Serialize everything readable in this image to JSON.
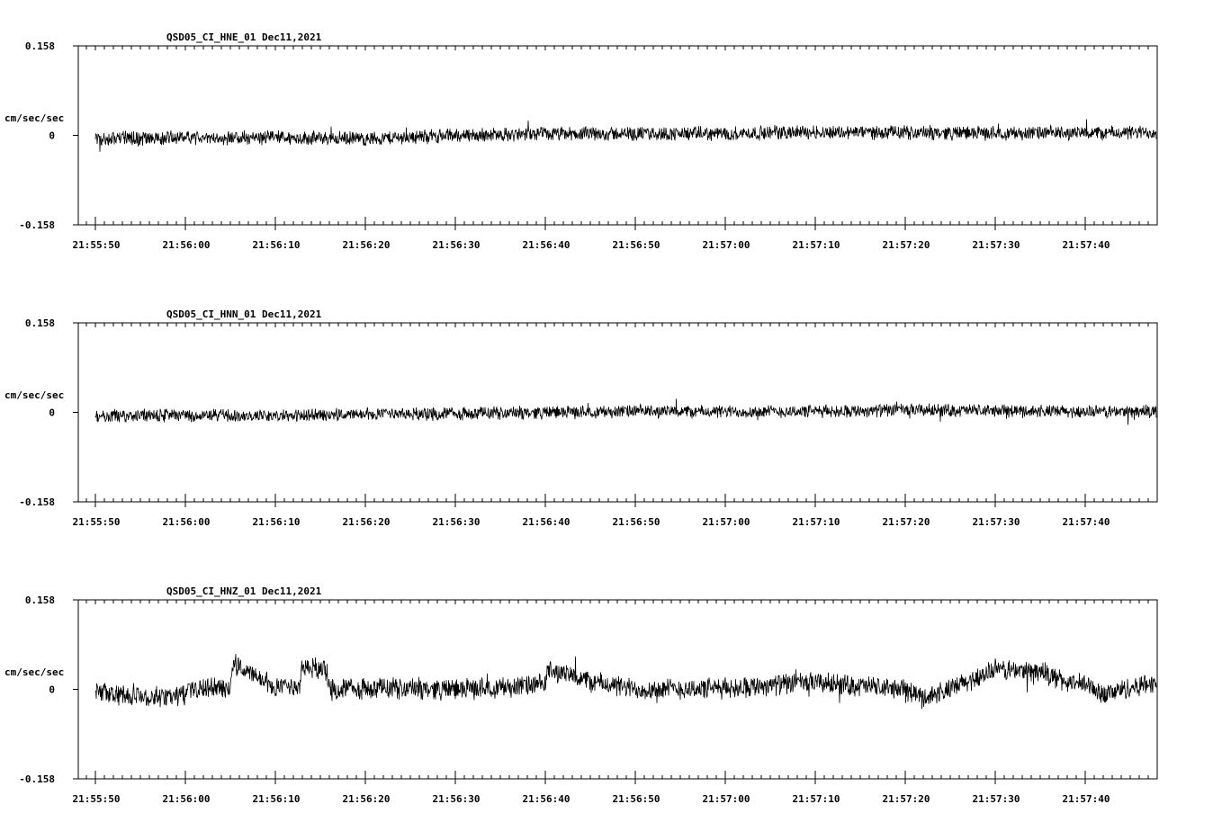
{
  "chart_data": [
    {
      "type": "line",
      "title": "QSD05_CI_HNE_01  Dec11,2021",
      "ylabel": "cm/sec/sec",
      "ylim": [
        -0.158,
        0.158
      ],
      "y_ticks": [
        "0.158",
        "0",
        "-0.158"
      ],
      "x_ticks": [
        "21:55:50",
        "21:56:00",
        "21:56:10",
        "21:56:20",
        "21:56:30",
        "21:56:40",
        "21:56:50",
        "21:57:00",
        "21:57:10",
        "21:57:20",
        "21:57:30",
        "21:57:40"
      ],
      "series": [
        {
          "color": "#000000",
          "noise_amplitude": 0.012,
          "baseline_x": [
            0,
            10,
            20,
            30,
            40,
            50,
            60,
            70,
            80,
            90,
            100,
            110,
            118
          ],
          "baseline_y": [
            -0.006,
            -0.005,
            -0.004,
            -0.006,
            0.0,
            0.002,
            0.003,
            0.003,
            0.006,
            0.005,
            0.004,
            0.004,
            0.005
          ]
        }
      ]
    },
    {
      "type": "line",
      "title": "QSD05_CI_HNN_01  Dec11,2021",
      "ylabel": "cm/sec/sec",
      "ylim": [
        -0.158,
        0.158
      ],
      "y_ticks": [
        "0.158",
        "0",
        "-0.158"
      ],
      "x_ticks": [
        "21:55:50",
        "21:56:00",
        "21:56:10",
        "21:56:20",
        "21:56:30",
        "21:56:40",
        "21:56:50",
        "21:57:00",
        "21:57:10",
        "21:57:20",
        "21:57:30",
        "21:57:40"
      ],
      "series": [
        {
          "color": "#000000",
          "noise_amplitude": 0.011,
          "baseline_x": [
            0,
            10,
            20,
            30,
            40,
            50,
            60,
            70,
            80,
            90,
            100,
            110,
            118
          ],
          "baseline_y": [
            -0.007,
            -0.005,
            -0.006,
            -0.004,
            -0.002,
            0.0,
            0.002,
            0.001,
            0.002,
            0.004,
            0.003,
            0.001,
            0.002
          ]
        }
      ]
    },
    {
      "type": "line",
      "title": "QSD05_CI_HNZ_01  Dec11,2021",
      "ylabel": "cm/sec/sec",
      "ylim": [
        -0.158,
        0.158
      ],
      "y_ticks": [
        "0.158",
        "0",
        "-0.158"
      ],
      "x_ticks": [
        "21:55:50",
        "21:56:00",
        "21:56:10",
        "21:56:20",
        "21:56:30",
        "21:56:40",
        "21:56:50",
        "21:57:00",
        "21:57:10",
        "21:57:20",
        "21:57:30",
        "21:57:40"
      ],
      "series": [
        {
          "color": "#000000",
          "noise_amplitude": 0.018,
          "baseline_x": [
            0,
            3,
            6,
            9,
            10,
            10.3,
            12,
            15,
            15.3,
            20,
            22.7,
            23,
            25.7,
            26,
            30,
            35,
            40,
            50,
            50.3,
            55,
            60,
            70,
            75,
            80,
            90,
            92,
            95,
            100,
            105,
            108,
            110,
            112,
            118
          ],
          "baseline_y": [
            -0.005,
            -0.012,
            -0.015,
            -0.01,
            -0.008,
            0.0,
            0.002,
            0.002,
            0.045,
            0.002,
            0.002,
            0.04,
            0.035,
            0.0,
            0.002,
            0.002,
            0.0,
            0.008,
            0.035,
            0.014,
            0.0,
            0.002,
            0.008,
            0.012,
            0.0,
            -0.015,
            0.0,
            0.035,
            0.032,
            0.012,
            0.008,
            -0.008,
            0.014
          ]
        }
      ]
    }
  ]
}
